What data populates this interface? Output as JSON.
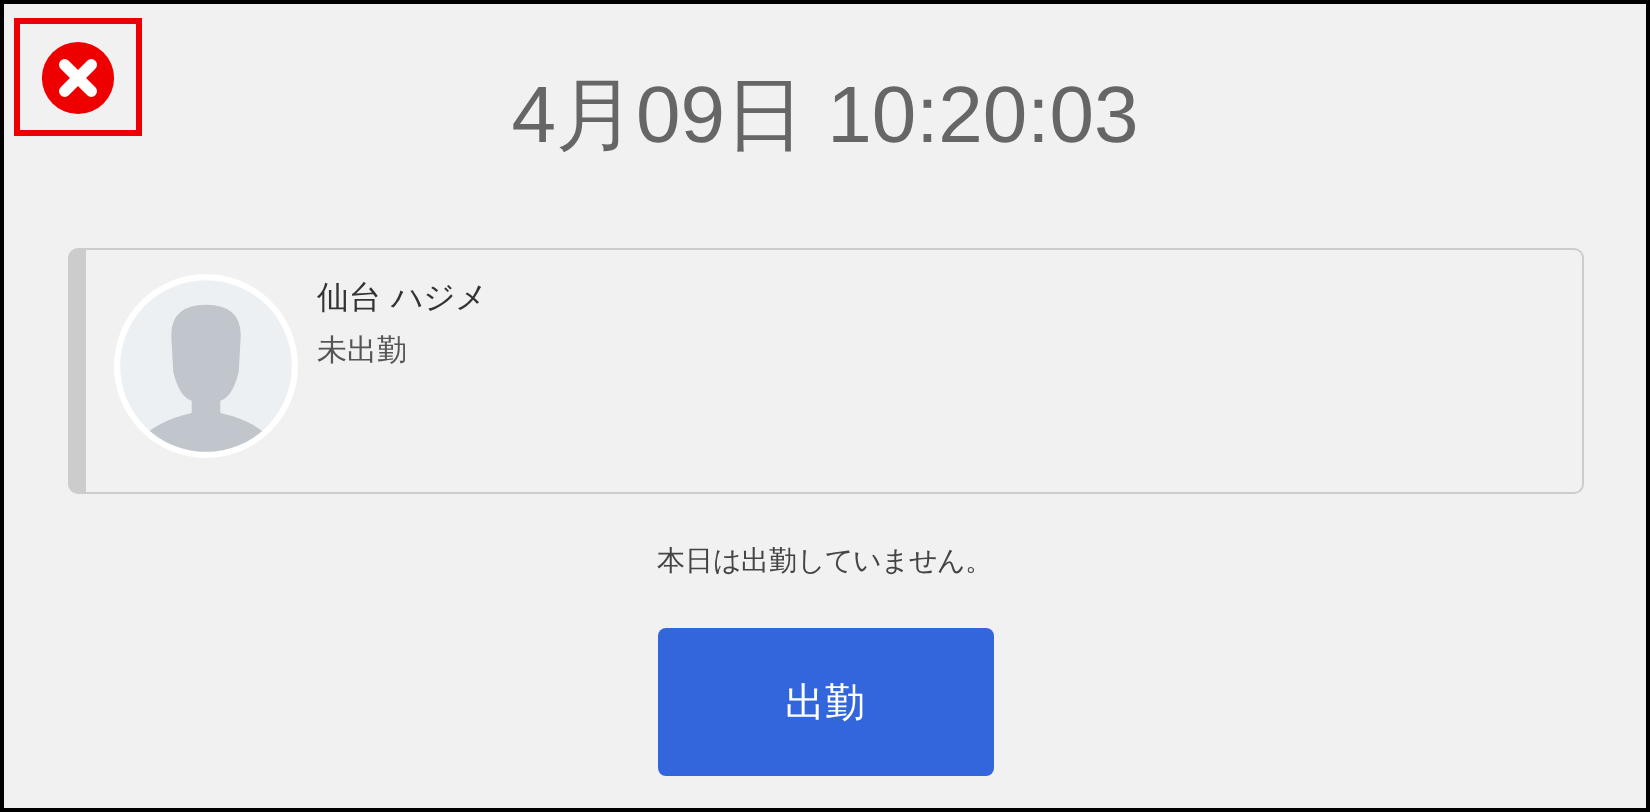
{
  "clock": "4月09日 10:20:03",
  "employee": {
    "name": "仙台 ハジメ",
    "status": "未出勤"
  },
  "message": "本日は出勤していません。",
  "buttons": [
    "出勤"
  ]
}
